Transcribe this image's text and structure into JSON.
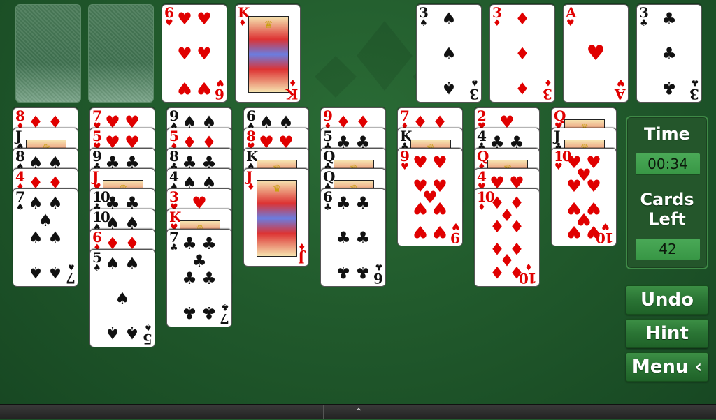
{
  "game": "FreeCell Solitaire",
  "colors": {
    "red_suit": "#e00000",
    "black_suit": "#111111",
    "felt": "#1f5a2c",
    "panel_value_bg": "#44a552"
  },
  "free_cells": [
    {
      "empty": true
    },
    {
      "empty": true
    },
    {
      "rank": "6",
      "suit": "hearts"
    },
    {
      "rank": "K",
      "suit": "diamonds"
    }
  ],
  "foundations": [
    {
      "rank": "3",
      "suit": "spades"
    },
    {
      "rank": "3",
      "suit": "diamonds"
    },
    {
      "rank": "A",
      "suit": "hearts"
    },
    {
      "rank": "3",
      "suit": "clubs"
    }
  ],
  "tableau": [
    [
      {
        "rank": "8",
        "suit": "diamonds"
      },
      {
        "rank": "J",
        "suit": "spades"
      },
      {
        "rank": "8",
        "suit": "spades"
      },
      {
        "rank": "4",
        "suit": "diamonds"
      },
      {
        "rank": "7",
        "suit": "spades"
      }
    ],
    [
      {
        "rank": "7",
        "suit": "hearts"
      },
      {
        "rank": "5",
        "suit": "hearts"
      },
      {
        "rank": "9",
        "suit": "clubs"
      },
      {
        "rank": "J",
        "suit": "hearts"
      },
      {
        "rank": "10",
        "suit": "clubs"
      },
      {
        "rank": "10",
        "suit": "spades"
      },
      {
        "rank": "6",
        "suit": "diamonds"
      },
      {
        "rank": "5",
        "suit": "spades"
      }
    ],
    [
      {
        "rank": "9",
        "suit": "spades"
      },
      {
        "rank": "5",
        "suit": "diamonds"
      },
      {
        "rank": "8",
        "suit": "clubs"
      },
      {
        "rank": "4",
        "suit": "spades"
      },
      {
        "rank": "3",
        "suit": "hearts"
      },
      {
        "rank": "K",
        "suit": "hearts"
      },
      {
        "rank": "7",
        "suit": "clubs"
      }
    ],
    [
      {
        "rank": "6",
        "suit": "spades"
      },
      {
        "rank": "8",
        "suit": "hearts"
      },
      {
        "rank": "K",
        "suit": "spades"
      },
      {
        "rank": "J",
        "suit": "diamonds"
      }
    ],
    [
      {
        "rank": "9",
        "suit": "diamonds"
      },
      {
        "rank": "5",
        "suit": "clubs"
      },
      {
        "rank": "Q",
        "suit": "clubs"
      },
      {
        "rank": "Q",
        "suit": "spades"
      },
      {
        "rank": "6",
        "suit": "clubs"
      }
    ],
    [
      {
        "rank": "7",
        "suit": "diamonds"
      },
      {
        "rank": "K",
        "suit": "clubs"
      },
      {
        "rank": "9",
        "suit": "hearts"
      }
    ],
    [
      {
        "rank": "2",
        "suit": "hearts"
      },
      {
        "rank": "4",
        "suit": "clubs"
      },
      {
        "rank": "Q",
        "suit": "diamonds"
      },
      {
        "rank": "4",
        "suit": "hearts"
      },
      {
        "rank": "10",
        "suit": "diamonds"
      }
    ],
    [
      {
        "rank": "Q",
        "suit": "hearts"
      },
      {
        "rank": "J",
        "suit": "clubs"
      },
      {
        "rank": "10",
        "suit": "hearts"
      }
    ]
  ],
  "panel": {
    "time_label": "Time",
    "time_value": "00:34",
    "cards_left_label_1": "Cards",
    "cards_left_label_2": "Left",
    "cards_left_value": "42"
  },
  "buttons": {
    "undo": "Undo",
    "hint": "Hint",
    "menu": "Menu ‹"
  },
  "navbar": {
    "up_icon": "⌃"
  }
}
